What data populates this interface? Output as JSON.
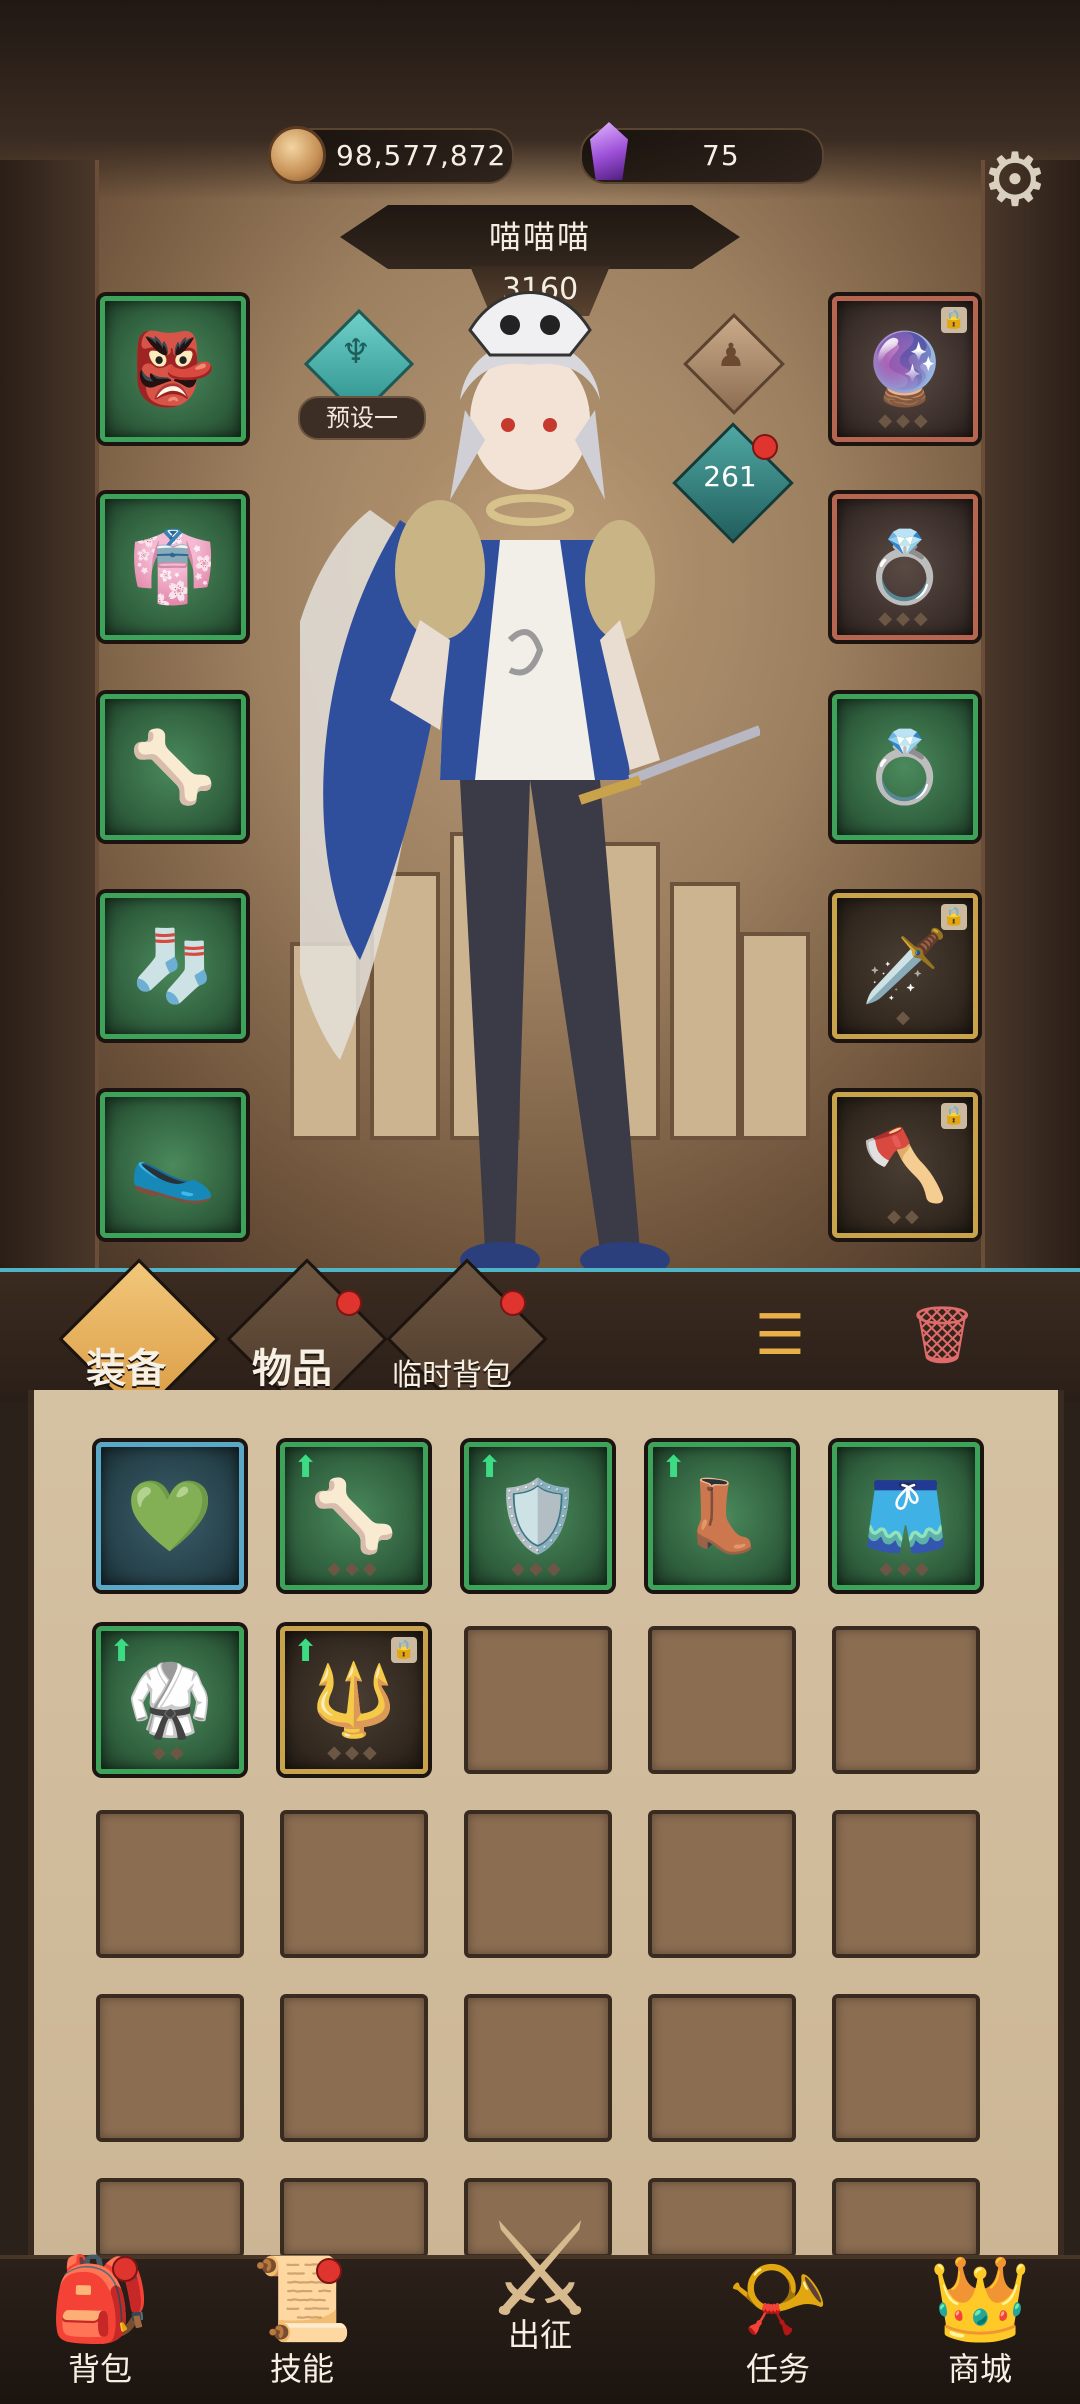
{
  "currency": {
    "gold": "98,577,872",
    "gems": "75",
    "gold_icon": "coin-icon",
    "gem_icon": "crystal-icon"
  },
  "character": {
    "name": "喵喵喵",
    "power": "3160",
    "preset_label": "预设一",
    "level": "261"
  },
  "equipment_left": [
    {
      "slot": "helmet",
      "icon": "👺",
      "frame": "green"
    },
    {
      "slot": "armor",
      "icon": "👘",
      "frame": "green"
    },
    {
      "slot": "bracer",
      "icon": "🦴",
      "frame": "green"
    },
    {
      "slot": "pants",
      "icon": "🧦",
      "frame": "green"
    },
    {
      "slot": "shoes",
      "icon": "🥿",
      "frame": "green"
    }
  ],
  "equipment_right": [
    {
      "slot": "amulet",
      "icon": "🔮",
      "frame": "red",
      "locked": true
    },
    {
      "slot": "ring",
      "icon": "💍",
      "frame": "red",
      "locked": false
    },
    {
      "slot": "ring2",
      "icon": "💍",
      "frame": "green",
      "locked": false
    },
    {
      "slot": "weapon",
      "icon": "🗡️",
      "frame": "gold",
      "locked": true
    },
    {
      "slot": "offhand",
      "icon": "🪓",
      "frame": "gold",
      "locked": true
    }
  ],
  "tabs": {
    "equipment": "装备",
    "items": "物品",
    "temp_bag": "临时背包"
  },
  "inventory": [
    {
      "icon": "💚",
      "frame": "blue",
      "upgrade": false,
      "locked": false
    },
    {
      "icon": "🦴",
      "frame": "green",
      "upgrade": true,
      "locked": false
    },
    {
      "icon": "🛡️",
      "frame": "green",
      "upgrade": true,
      "locked": false
    },
    {
      "icon": "👢",
      "frame": "green",
      "upgrade": true,
      "locked": false
    },
    {
      "icon": "🩳",
      "frame": "green",
      "upgrade": false,
      "locked": false
    },
    {
      "icon": "🥋",
      "frame": "green",
      "upgrade": true,
      "locked": false
    },
    {
      "icon": "🔱",
      "frame": "gold",
      "upgrade": true,
      "locked": true
    }
  ],
  "bottom_nav": {
    "bag": "背包",
    "skills": "技能",
    "expedition": "出征",
    "quests": "任务",
    "shop": "商城"
  }
}
